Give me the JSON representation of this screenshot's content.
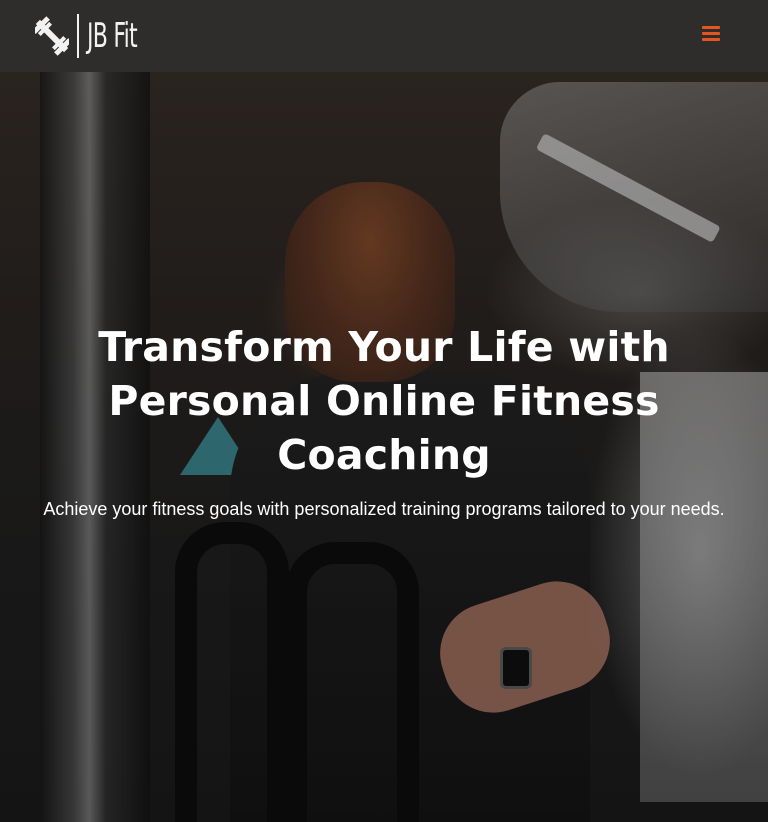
{
  "header": {
    "logo_text": "JB Fit",
    "logo_icon": "dumbbell-icon",
    "menu_icon": "hamburger-menu-icon",
    "background_color": "#2f2d2b",
    "accent_color": "#e8541d"
  },
  "hero": {
    "title": "Transform Your Life with Personal Online Fitness Coaching",
    "subtitle": "Achieve your fitness goals with personalized training programs tailored to your needs.",
    "text_color": "#ffffff"
  }
}
